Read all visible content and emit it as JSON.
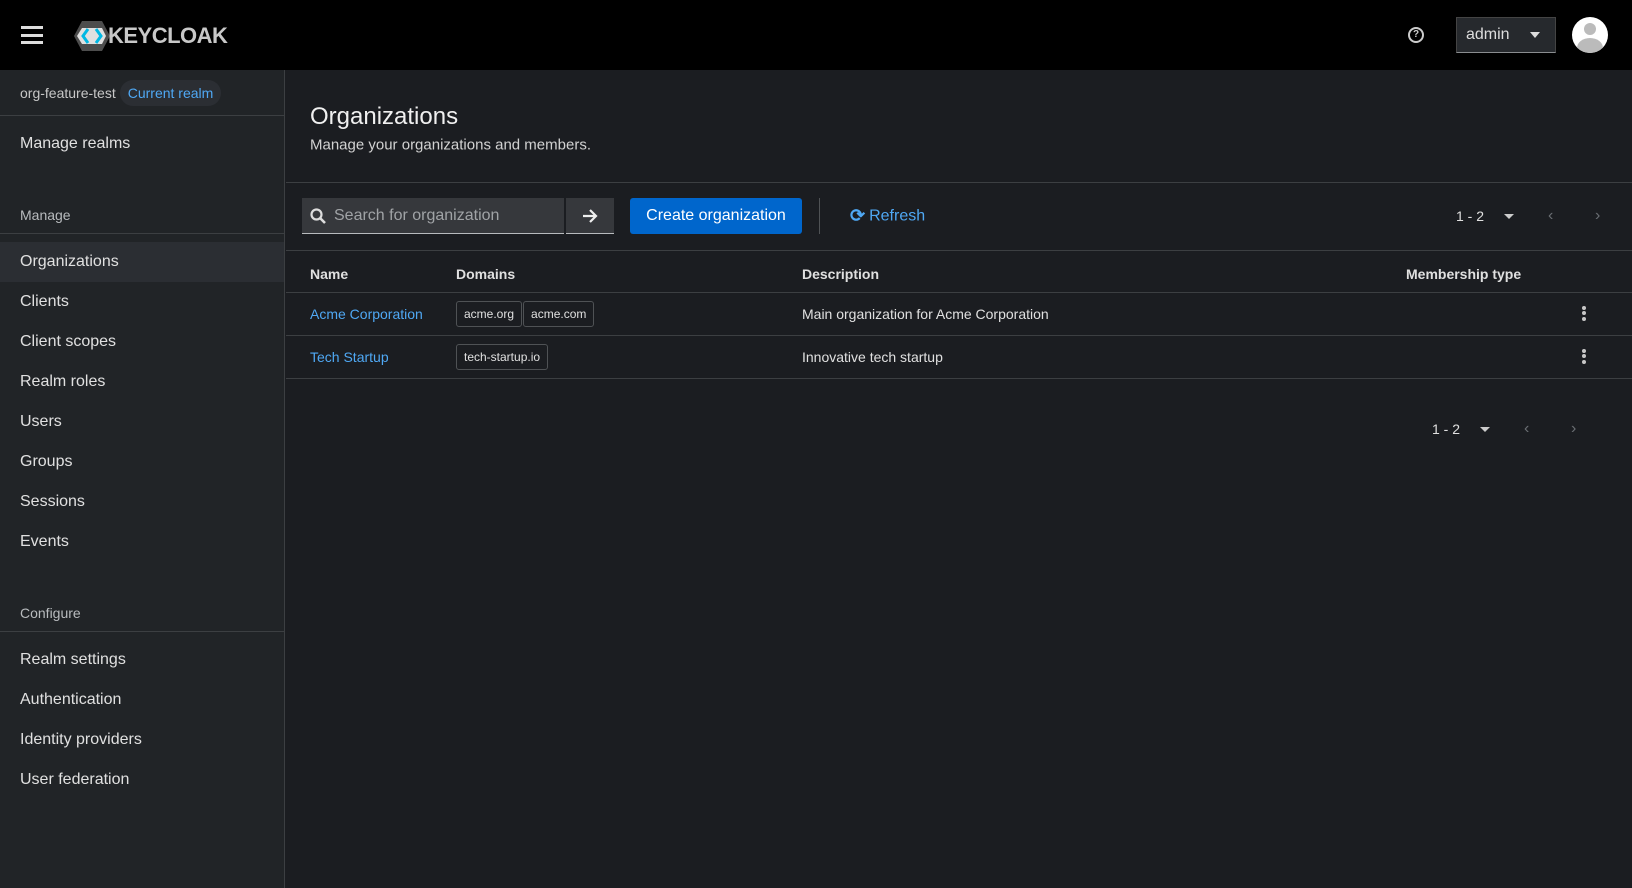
{
  "header": {
    "brand": "KEYCLOAK",
    "user": "admin"
  },
  "sidebar": {
    "realm": "org-feature-test",
    "realm_badge": "Current realm",
    "manage_realms": "Manage realms",
    "manage_label": "Manage",
    "manage_items": [
      "Organizations",
      "Clients",
      "Client scopes",
      "Realm roles",
      "Users",
      "Groups",
      "Sessions",
      "Events"
    ],
    "configure_label": "Configure",
    "configure_items": [
      "Realm settings",
      "Authentication",
      "Identity providers",
      "User federation"
    ],
    "active": "Organizations"
  },
  "page": {
    "title": "Organizations",
    "subtitle": "Manage your organizations and members."
  },
  "toolbar": {
    "search_placeholder": "Search for organization",
    "create": "Create organization",
    "refresh": "Refresh",
    "pagination": "1 - 2"
  },
  "table": {
    "headers": [
      "Name",
      "Domains",
      "Description",
      "Membership type"
    ],
    "rows": [
      {
        "name": "Acme Corporation",
        "domains": [
          "acme.org",
          "acme.com"
        ],
        "description": "Main organization for Acme Corporation",
        "membership": ""
      },
      {
        "name": "Tech Startup",
        "domains": [
          "tech-startup.io"
        ],
        "description": "Innovative tech startup",
        "membership": ""
      }
    ]
  },
  "footer": {
    "pagination": "1 - 2"
  },
  "colors": {
    "primary": "#0066cc",
    "link": "#4fa8f4"
  }
}
